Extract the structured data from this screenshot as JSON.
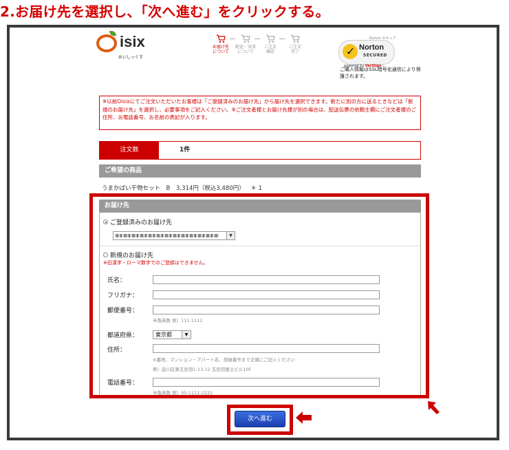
{
  "heading": "2.お届け先を選択し、「次へ進む」をクリックする。",
  "logo": {
    "text": "isix",
    "sub": "おいしっくす"
  },
  "steps": [
    {
      "label": "お届け先\nについて",
      "active": true
    },
    {
      "label": "配送・決済\nについて",
      "active": false
    },
    {
      "label": "ご注文\n確認",
      "active": false
    },
    {
      "label": "ご注文\n完了",
      "active": false
    }
  ],
  "norton": {
    "top": "Norton セキュア",
    "name": "Norton",
    "secured": "SECURED",
    "powered": "powered by",
    "verisign": "VeriSign"
  },
  "secure_note": "ご購入情報はSSL暗号化通信により保護されます。",
  "notice": "※以前Oisixにてご注文いただいたお客様は「ご登録済みのお届け先」から届け先を選択できます。新たに別の方に送るときなどは「新規のお届け先」を選択し、必要事項をご記入ください。※ご注文者様とお届け先様が別の場合は、配送伝票の依頼主欄にご注文者様のご住所、お電話番号、お名前の表記が入ります。",
  "order_count": {
    "label": "注文数",
    "value": "1件"
  },
  "product": {
    "header": "ご希望の商品",
    "name": "うまかばい干物セット　B",
    "price": "3,314円（税込3,480円）",
    "qty": "＊ 1"
  },
  "destination": {
    "header": "お届け先",
    "registered_label": "ご登録済みのお届け先",
    "new_label": "新規のお届け先",
    "new_warning": "※旧漢字・ローマ数字でのご登録はできません。"
  },
  "form": {
    "name_label": "氏名：",
    "kana_label": "フリガナ：",
    "zip_label": "郵便番号：",
    "zip_hint": "半角英数 例）111-1111",
    "pref_label": "都道府県：",
    "pref_value": "東京都",
    "address_label": "住所：",
    "address_hint1": "※番地、マンション・アパート名、部屋番号まで正確にご記入ください",
    "address_hint2": "例）品川区東五反田1-13-12 五反田富士ビル10F",
    "phone_label": "電話番号：",
    "phone_hint": "半角英数 例）00-1111-2222"
  },
  "next_button": "次へ進む"
}
